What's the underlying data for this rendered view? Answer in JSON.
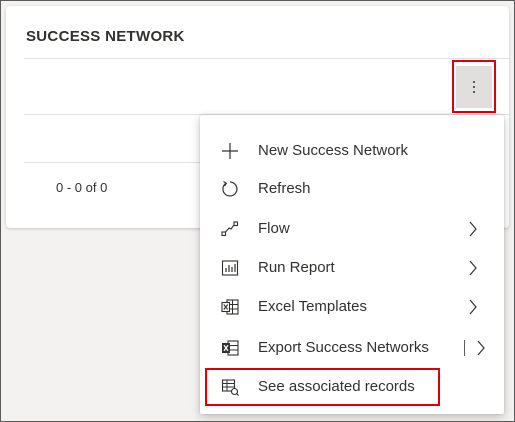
{
  "card": {
    "title": "SUCCESS NETWORK",
    "paging": "0 - 0 of 0"
  },
  "toolbar": {
    "more_icon": "more-vertical-icon"
  },
  "menu": {
    "items": [
      {
        "label": "New Success Network",
        "icon": "plus-icon",
        "submenu": false
      },
      {
        "label": "Refresh",
        "icon": "refresh-icon",
        "submenu": false
      },
      {
        "label": "Flow",
        "icon": "flow-icon",
        "submenu": true
      },
      {
        "label": "Run Report",
        "icon": "report-icon",
        "submenu": true
      },
      {
        "label": "Excel Templates",
        "icon": "excel-template-icon",
        "submenu": true
      },
      {
        "label": "Export Success Networks",
        "icon": "excel-export-icon",
        "submenu": true,
        "split": true
      },
      {
        "label": "See associated records",
        "icon": "associated-records-icon",
        "submenu": false
      }
    ]
  },
  "colors": {
    "highlight": "#d9000a",
    "text": "#323130",
    "button_bg": "#e1dfdd"
  }
}
